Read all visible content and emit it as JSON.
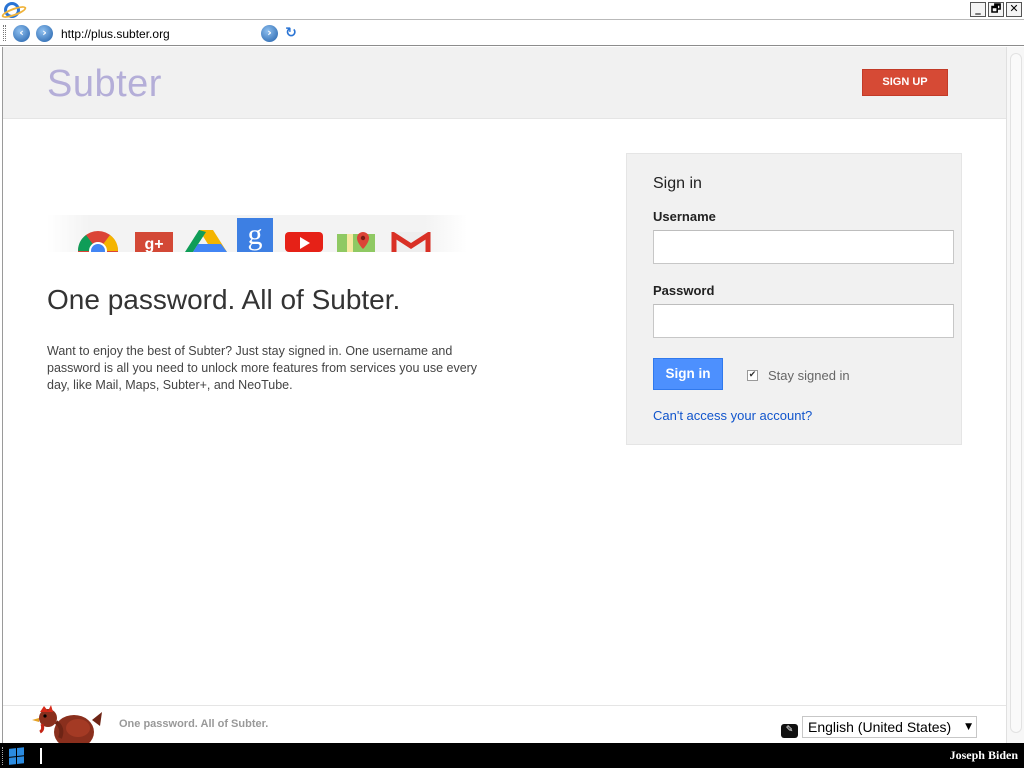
{
  "browser": {
    "url": "http://plus.subter.org",
    "window_buttons": [
      "_",
      "🗗",
      "✕"
    ]
  },
  "header": {
    "logo": "Subter",
    "signup_label": "SIGN UP"
  },
  "hero": {
    "service_icons": [
      "chrome-icon",
      "plus-icon",
      "drive-icon",
      "search-icon",
      "video-icon",
      "maps-icon",
      "mail-icon"
    ],
    "tagline": "One password. All of Subter.",
    "description": "Want to enjoy the best of Subter? Just stay signed in. One username and password is all you need to unlock more features from services you use every day, like Mail, Maps, Subter+, and NeoTube."
  },
  "signin": {
    "title": "Sign in",
    "username_label": "Username",
    "username_value": "",
    "password_label": "Password",
    "password_value": "",
    "button_label": "Sign in",
    "stay_signed_in_label": "Stay signed in",
    "stay_signed_in_checked": true,
    "cant_access_label": "Can't access your account?"
  },
  "footer": {
    "text": "One password. All of Subter.",
    "language": "English (United States)"
  },
  "taskbar": {
    "user": "Joseph Biden"
  },
  "colors": {
    "signup": "#d64a35",
    "signin_button": "#4d90fe",
    "link": "#1155cc",
    "logo": "#b4aed8"
  }
}
